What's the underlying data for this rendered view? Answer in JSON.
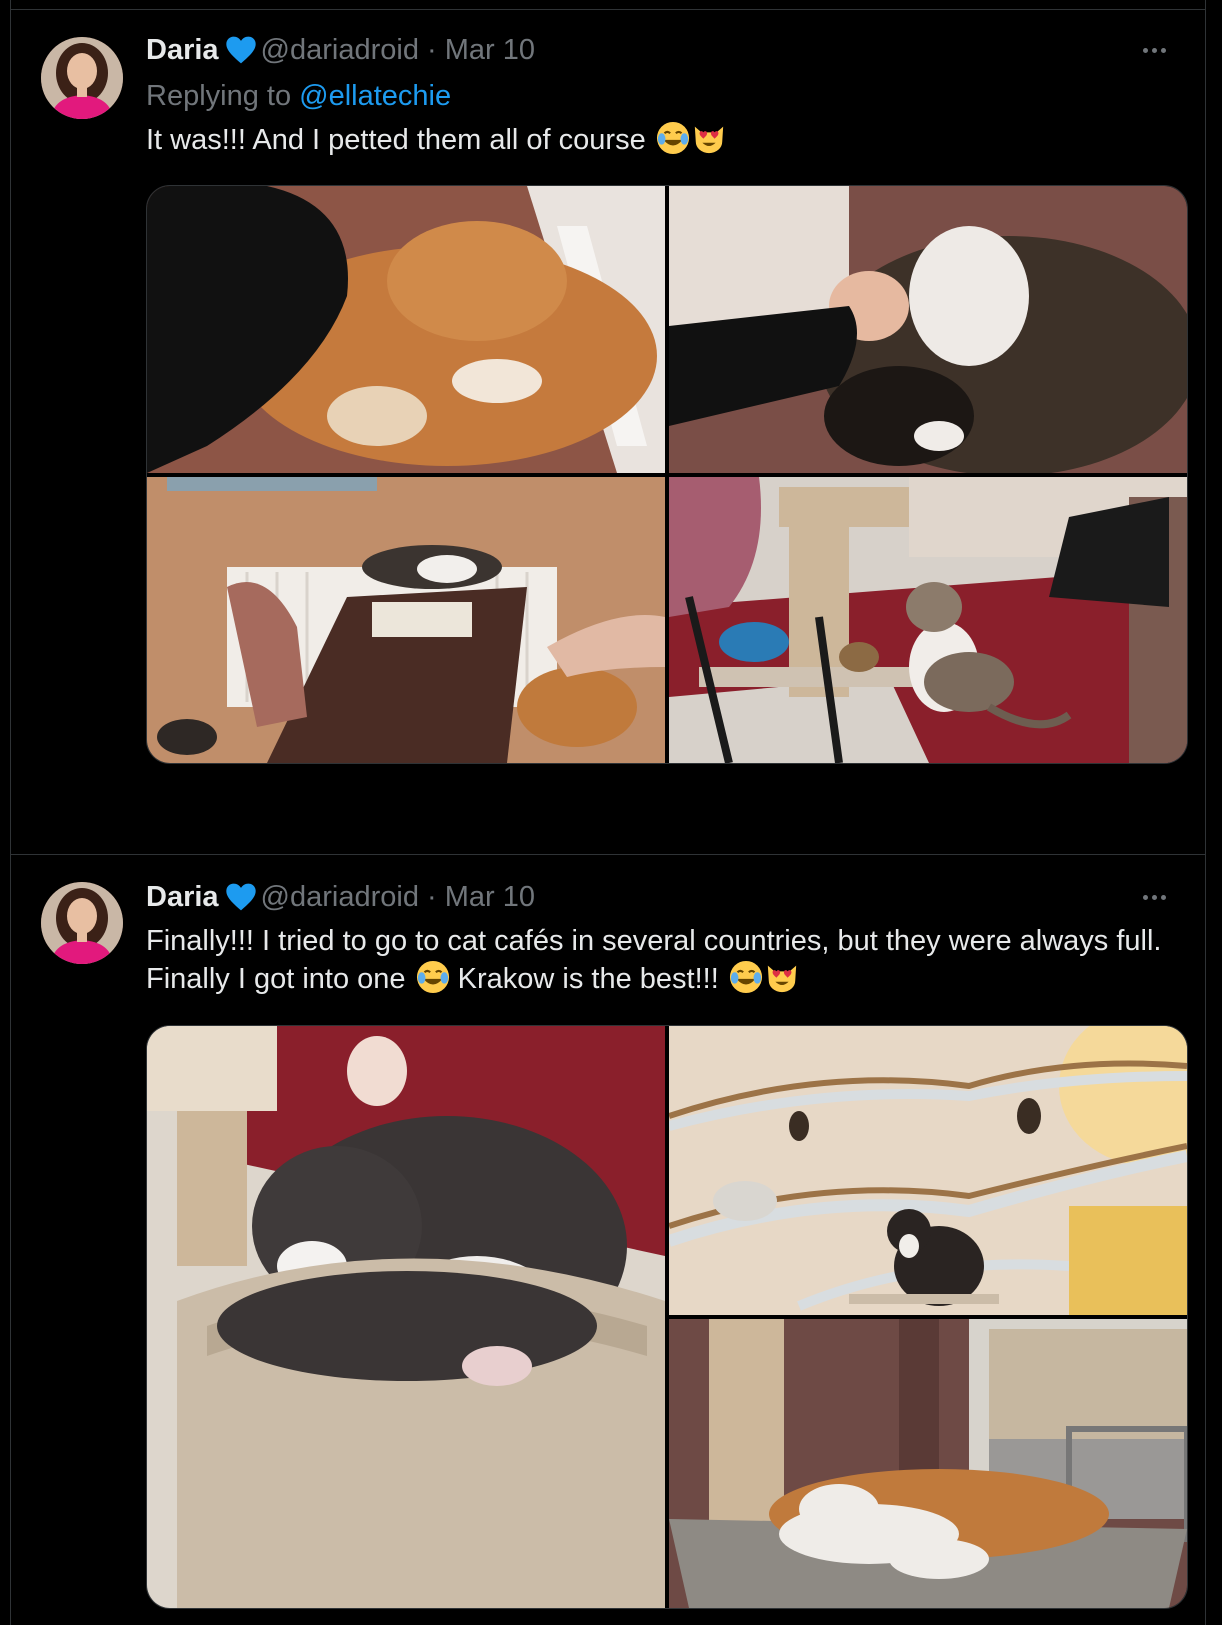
{
  "tweets": [
    {
      "author_name": "Daria",
      "handle": "@dariadroid",
      "separator": "·",
      "date": "Mar 10",
      "replying_to_prefix": "Replying to ",
      "replying_to_handle": "@ellatechie",
      "text": "It was!!! And I petted them all of course",
      "emojis": [
        "face-with-tears-of-joy",
        "smiling-cat-with-heart-eyes"
      ],
      "images": [
        {
          "description_icon": "photo-ginger-cat-being-petted"
        },
        {
          "description_icon": "photo-tabby-cat-sleeping"
        },
        {
          "description_icon": "photo-cats-at-table"
        },
        {
          "description_icon": "photo-calico-cat-on-red-carpet"
        }
      ]
    },
    {
      "author_name": "Daria",
      "handle": "@dariadroid",
      "separator": "·",
      "date": "Mar 10",
      "text_part1": "Finally!!! I tried to go to cat cafés in several countries, but they were always full. Finally I got into one",
      "text_part2": " Krakow is the best!!!",
      "emojis": [
        "face-with-tears-of-joy",
        "face-with-tears-of-joy",
        "smiling-cat-with-heart-eyes"
      ],
      "images": [
        {
          "description_icon": "photo-fluffy-cat-in-basket"
        },
        {
          "description_icon": "photo-tortoiseshell-cat-on-shelf"
        },
        {
          "description_icon": "photo-cat-sleeping-by-window"
        }
      ]
    }
  ],
  "colors": {
    "background": "#000000",
    "text": "#e7e9ea",
    "muted": "#71767b",
    "link": "#1d9bf0",
    "border": "#2f3336",
    "verified": "#1d9bf0"
  }
}
